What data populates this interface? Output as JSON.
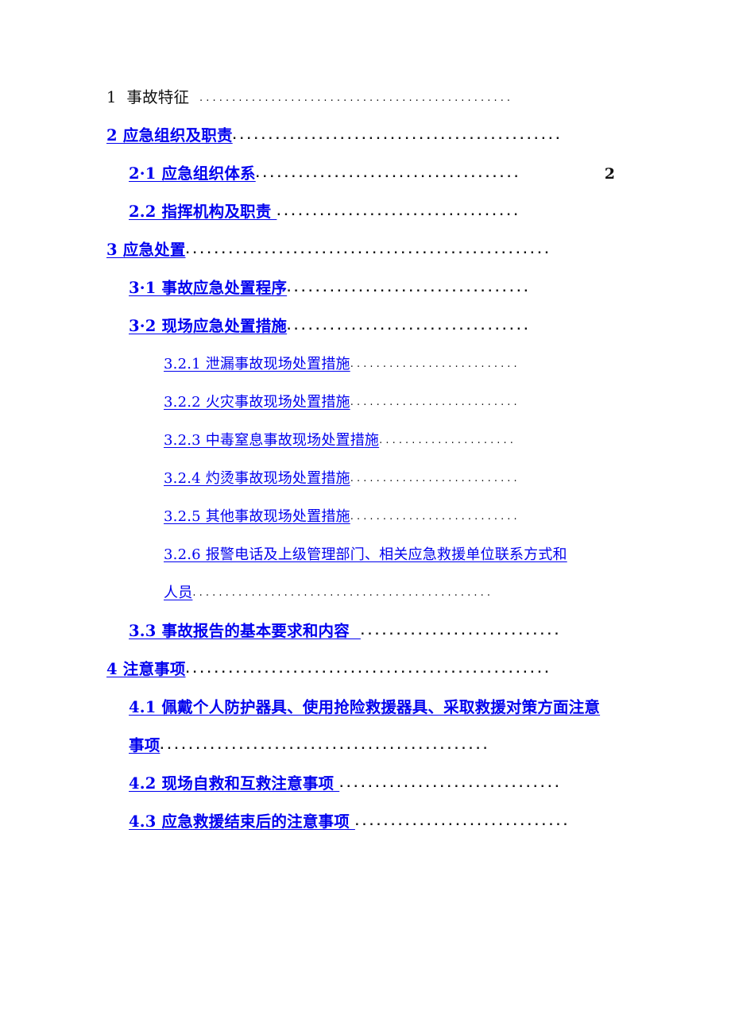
{
  "document": {
    "type": "table-of-contents",
    "language": "zh-CN",
    "link_color": "#0000EE",
    "text_color": "#111111"
  },
  "toc": {
    "entries": [
      {
        "id": "entry-1",
        "level": 1,
        "style": "plain",
        "label": "1  事故特征  ",
        "leader": "................................................",
        "page": ""
      },
      {
        "id": "entry-2",
        "level": 1,
        "style": "link",
        "label": "2 应急组织及职责",
        "leader": "..............................................",
        "page": ""
      },
      {
        "id": "entry-2-1",
        "level": 2,
        "style": "link",
        "label": "2·1 应急组织体系",
        "leader": ".....................................",
        "page": "2"
      },
      {
        "id": "entry-2-2",
        "level": 2,
        "style": "link",
        "label": "2.2 指挥机构及职责 ",
        "leader": "..................................",
        "page": ""
      },
      {
        "id": "entry-3",
        "level": 1,
        "style": "link",
        "label": "3 应急处置",
        "leader": "...................................................",
        "page": ""
      },
      {
        "id": "entry-3-1",
        "level": 2,
        "style": "link",
        "label": "3·1 事故应急处置程序",
        "leader": "..................................",
        "page": ""
      },
      {
        "id": "entry-3-2",
        "level": 2,
        "style": "link",
        "label": "3·2 现场应急处置措施",
        "leader": "..................................",
        "page": ""
      },
      {
        "id": "entry-3-2-1",
        "level": 3,
        "style": "link",
        "label": "3.2.1 泄漏事故现场处置措施",
        "leader": "..........................",
        "page": ""
      },
      {
        "id": "entry-3-2-2",
        "level": 3,
        "style": "link",
        "label": "3.2.2 火灾事故现场处置措施",
        "leader": "..........................",
        "page": ""
      },
      {
        "id": "entry-3-2-3",
        "level": 3,
        "style": "link",
        "label": "3.2.3 中毒窒息事故现场处置措施",
        "leader": ".....................",
        "page": ""
      },
      {
        "id": "entry-3-2-4",
        "level": 3,
        "style": "link",
        "label": "3.2.4 灼烫事故现场处置措施",
        "leader": "..........................",
        "page": ""
      },
      {
        "id": "entry-3-2-5",
        "level": 3,
        "style": "link",
        "label": "3.2.5 其他事故现场处置措施",
        "leader": "..........................",
        "page": ""
      },
      {
        "id": "entry-3-2-6",
        "level": 3,
        "style": "link",
        "wrapped": true,
        "label": "3.2.6 报警电话及上级管理部门、相关应急救援单位联系方式和",
        "label_line2": "人员",
        "leader": "..............................................",
        "page": ""
      },
      {
        "id": "entry-3-3",
        "level": 2,
        "style": "link",
        "label": "3.3 事故报告的基本要求和内容  ",
        "leader": "............................",
        "page": ""
      },
      {
        "id": "entry-4",
        "level": 1,
        "style": "link",
        "label": "4 注意事项",
        "leader": "...................................................",
        "page": ""
      },
      {
        "id": "entry-4-1",
        "level": 2,
        "style": "link",
        "wrapped": true,
        "label": "4.1 佩戴个人防护器具、使用抢险救援器具、采取救援对策方面注意",
        "label_line2": "事项",
        "leader": "..............................................",
        "page": ""
      },
      {
        "id": "entry-4-2",
        "level": 2,
        "style": "link",
        "label": "4.2 现场自救和互救注意事项 ",
        "leader": "...............................",
        "page": ""
      },
      {
        "id": "entry-4-3",
        "level": 2,
        "style": "link",
        "label": "4.3 应急救援结束后的注意事项 ",
        "leader": "..............................",
        "page": ""
      }
    ]
  }
}
